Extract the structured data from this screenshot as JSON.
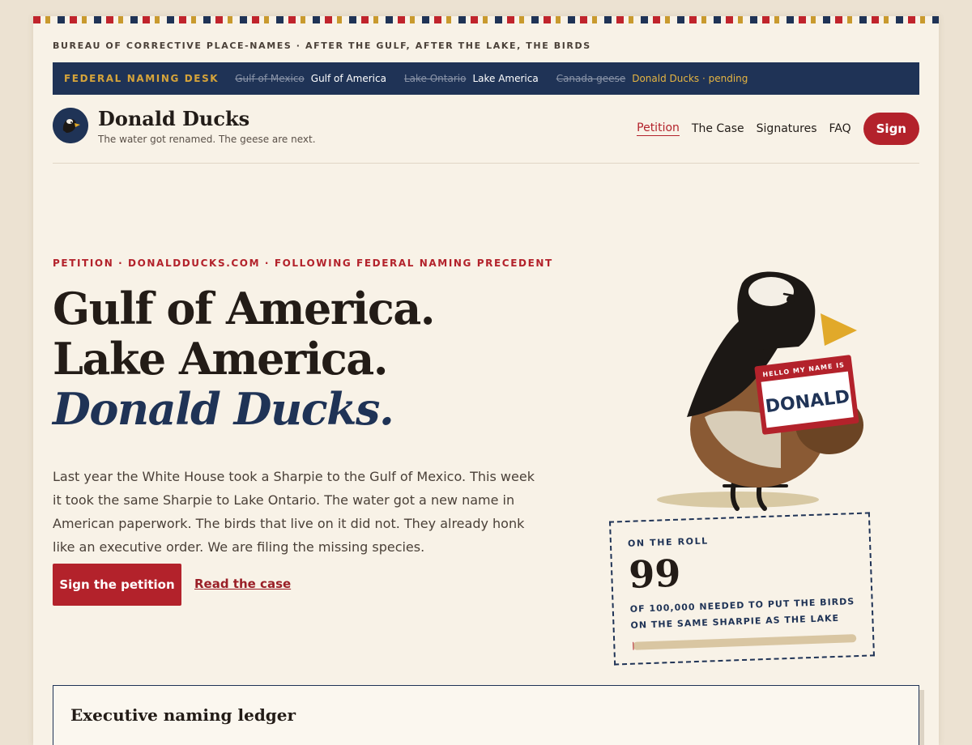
{
  "bureau_line": "BUREAU OF CORRECTIVE PLACE-NAMES · AFTER THE GULF, AFTER THE LAKE, THE BIRDS",
  "naming_desk": {
    "label": "FEDERAL NAMING DESK",
    "items": [
      {
        "old": "Gulf of Mexico",
        "new": "Gulf of America",
        "status": "done"
      },
      {
        "old": "Lake Ontario",
        "new": "Lake America",
        "status": "done"
      },
      {
        "old": "Canada geese",
        "new": "Donald Ducks · pending",
        "status": "pending"
      }
    ]
  },
  "brand": {
    "name": "Donald Ducks",
    "tagline": "The water got renamed. The geese are next."
  },
  "nav": {
    "items": [
      {
        "label": "Petition",
        "active": true
      },
      {
        "label": "The Case",
        "active": false
      },
      {
        "label": "Signatures",
        "active": false
      },
      {
        "label": "FAQ",
        "active": false
      }
    ],
    "sign_label": "Sign"
  },
  "hero": {
    "kicker": "PETITION · DONALDDUCKS.COM · FOLLOWING FEDERAL NAMING PRECEDENT",
    "headline_line1": "Gulf of America. Lake America.",
    "headline_accent": "Donald Ducks.",
    "lede": "Last year the White House took a Sharpie to the Gulf of Mexico. This week it took the same Sharpie to Lake Ontario. The water got a new name in American paperwork. The birds that live on it did not. They already honk like an executive order. We are filing the missing species.",
    "cta_label": "Sign the petition",
    "secondary_link": "Read the case"
  },
  "name_tag": {
    "header": "HELLO MY NAME IS",
    "name": "DONALD"
  },
  "roll": {
    "label": "ON THE ROLL",
    "count": "99",
    "description": "of 100,000 needed to put the birds on the same Sharpie as the lake",
    "progress": 0.00099
  },
  "ledger": {
    "title": "Executive naming ledger"
  },
  "colors": {
    "red": "#b3222b",
    "navy": "#1f3356",
    "gold": "#d6a43a",
    "cream": "#f8f2e7"
  }
}
